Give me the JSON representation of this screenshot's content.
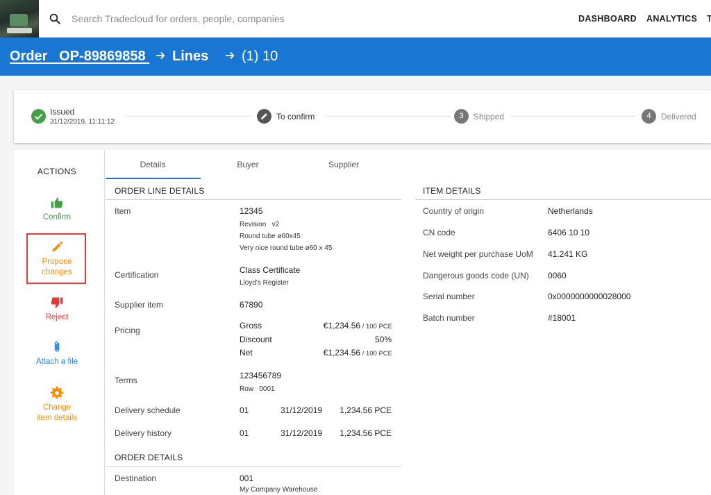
{
  "search": {
    "placeholder": "Search Tradecloud for orders, people, companies"
  },
  "nav": {
    "dashboard": "DASHBOARD",
    "analytics": "ANALYTICS",
    "edge": "T"
  },
  "breadcrumb": {
    "order": "Order   OP-89869858 ",
    "lines": "Lines",
    "line": "(1) 10"
  },
  "stepper": {
    "steps": [
      {
        "label": "Issued",
        "sub": "31/12/2019, 11:11:12",
        "state": "done"
      },
      {
        "label": "To confirm",
        "state": "current"
      },
      {
        "label": "Shipped",
        "number": "3",
        "state": "pending"
      },
      {
        "label": "Delivered",
        "number": "4",
        "state": "pending"
      }
    ]
  },
  "actions": {
    "title": "ACTIONS",
    "confirm": "Confirm",
    "propose_1": "Propose",
    "propose_2": "changes",
    "reject": "Reject",
    "attach": "Attach a file",
    "change_1": "Change",
    "change_2": "item details"
  },
  "tabs": {
    "details": "Details",
    "buyer": "Buyer",
    "supplier": "Supplier"
  },
  "order_line": {
    "title": "ORDER LINE DETAILS",
    "item_label": "Item",
    "item_value": "12345",
    "item_revision": "Revision   v2",
    "item_name": "Round tube ø60x45",
    "item_desc": "Very nice round tube ø60 x 45",
    "cert_label": "Certification",
    "cert_value": "Class Certificate",
    "cert_issuer": "Lloyd's Register",
    "supplier_item_label": "Supplier item",
    "supplier_item_value": "67890",
    "pricing_label": "Pricing",
    "gross_label": "Gross",
    "gross_value": "€1,234.56",
    "gross_unit": " / 100 PCE",
    "discount_label": "Discount",
    "discount_value": "50%",
    "net_label": "Net",
    "net_value": "€1,234.56",
    "net_unit": " / 100 PCE",
    "terms_label": "Terms",
    "terms_value": "123456789",
    "terms_row": "Row   0001",
    "schedule_label": "Delivery schedule",
    "schedule_no": "01",
    "schedule_date": "31/12/2019",
    "schedule_qty": "1,234.56 PCE",
    "history_label": "Delivery history",
    "history_no": "01",
    "history_date": "31/12/2019",
    "history_qty": "1,234.56 PCE"
  },
  "order_details": {
    "title": "ORDER DETAILS",
    "destination_label": "Destination",
    "destination_value": "001",
    "destination_name": "My Company Warehouse"
  },
  "item_details": {
    "title": "ITEM DETAILS",
    "rows": [
      {
        "label": "Country of origin",
        "value": "Netherlands"
      },
      {
        "label": "CN code",
        "value": "6406 10 10"
      },
      {
        "label": "Net weight per purchase UoM",
        "value": "41.241 KG"
      },
      {
        "label": "Dangerous goods code (UN)",
        "value": "0060"
      },
      {
        "label": "Serial number",
        "value": "0x0000000000028000"
      },
      {
        "label": "Batch number",
        "value": "#18001"
      }
    ]
  },
  "colors": {
    "brand": "#1976d2",
    "success": "#43a047",
    "warning": "#fb8c00",
    "danger": "#e53935",
    "info": "#1e88e5"
  }
}
